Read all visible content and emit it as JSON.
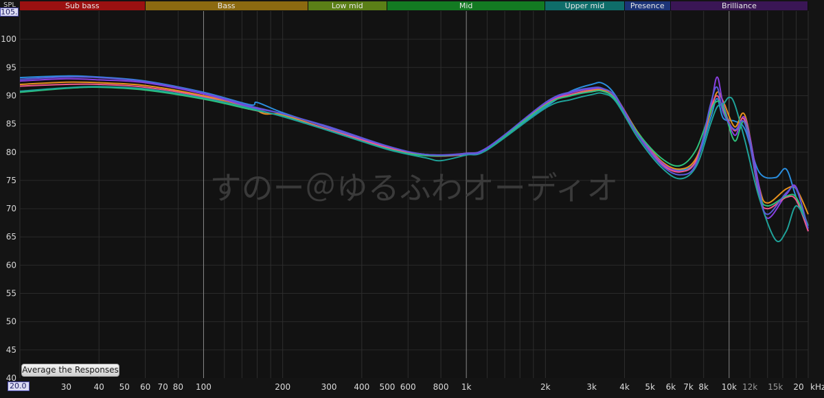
{
  "bands": [
    {
      "label": "Sub bass",
      "from": 20,
      "to": 60,
      "color": "#9b1111"
    },
    {
      "label": "Bass",
      "from": 60,
      "to": 250,
      "color": "#8c6a10"
    },
    {
      "label": "Low mid",
      "from": 250,
      "to": 500,
      "color": "#5b7f17"
    },
    {
      "label": "Mid",
      "from": 500,
      "to": 2000,
      "color": "#137a22"
    },
    {
      "label": "Upper mid",
      "from": 2000,
      "to": 4000,
      "color": "#0f6d6a"
    },
    {
      "label": "Presence",
      "from": 4000,
      "to": 6000,
      "color": "#1c3478"
    },
    {
      "label": "Brilliance",
      "from": 6000,
      "to": 20000,
      "color": "#3a1655"
    }
  ],
  "axis": {
    "y_unit": "SPL",
    "y_max_label": "105.0",
    "x_min_label": "20.0",
    "x_unit": "kHz"
  },
  "watermark": "すのー＠ゆるふわオーディオ",
  "button": {
    "label": "Average the Responses"
  },
  "chart_data": {
    "type": "line",
    "xscale": "log",
    "xlim": [
      20,
      20000
    ],
    "ylim": [
      40,
      105
    ],
    "grid": true,
    "y_ticks": [
      100,
      95,
      90,
      85,
      80,
      75,
      70,
      65,
      60,
      55,
      50,
      45,
      40
    ],
    "x_ticks": [
      {
        "value": 30,
        "label": "30"
      },
      {
        "value": 40,
        "label": "40"
      },
      {
        "value": 50,
        "label": "50"
      },
      {
        "value": 60,
        "label": "60"
      },
      {
        "value": 70,
        "label": "70"
      },
      {
        "value": 80,
        "label": "80"
      },
      {
        "value": 100,
        "label": "100"
      },
      {
        "value": 200,
        "label": "200"
      },
      {
        "value": 300,
        "label": "300"
      },
      {
        "value": 400,
        "label": "400"
      },
      {
        "value": 500,
        "label": "500"
      },
      {
        "value": 600,
        "label": "600"
      },
      {
        "value": 800,
        "label": "800"
      },
      {
        "value": 1000,
        "label": "1k"
      },
      {
        "value": 2000,
        "label": "2k"
      },
      {
        "value": 3000,
        "label": "3k"
      },
      {
        "value": 4000,
        "label": "4k"
      },
      {
        "value": 5000,
        "label": "5k"
      },
      {
        "value": 6000,
        "label": "6k"
      },
      {
        "value": 7000,
        "label": "7k"
      },
      {
        "value": 8000,
        "label": "8k"
      },
      {
        "value": 10000,
        "label": "10k"
      },
      {
        "value": 12000,
        "label": "12k",
        "minor": true
      },
      {
        "value": 15000,
        "label": "15k",
        "minor": true
      },
      {
        "value": 20000,
        "label": "20"
      }
    ],
    "series": [
      {
        "color": "#2a8fe0",
        "points": [
          [
            20,
            93.2
          ],
          [
            30,
            93.5
          ],
          [
            40,
            93.3
          ],
          [
            60,
            92.6
          ],
          [
            100,
            90.6
          ],
          [
            150,
            88.4
          ],
          [
            160,
            88.8
          ],
          [
            200,
            87.0
          ],
          [
            300,
            84.3
          ],
          [
            500,
            81.0
          ],
          [
            700,
            79.5
          ],
          [
            1000,
            79.8
          ],
          [
            1200,
            80.8
          ],
          [
            2000,
            88.0
          ],
          [
            2500,
            90.8
          ],
          [
            3000,
            92.0
          ],
          [
            3300,
            92.2
          ],
          [
            3700,
            90.0
          ],
          [
            4500,
            83.0
          ],
          [
            5500,
            78.0
          ],
          [
            6500,
            76.8
          ],
          [
            7500,
            78.5
          ],
          [
            8500,
            86.0
          ],
          [
            9000,
            89.5
          ],
          [
            9500,
            86.0
          ],
          [
            10500,
            85.5
          ],
          [
            11500,
            84.0
          ],
          [
            13000,
            76.5
          ],
          [
            15000,
            75.5
          ],
          [
            16500,
            77.0
          ],
          [
            18000,
            72.0
          ],
          [
            20000,
            67.0
          ]
        ]
      },
      {
        "color": "#e6921e",
        "points": [
          [
            20,
            92.0
          ],
          [
            30,
            92.4
          ],
          [
            40,
            92.3
          ],
          [
            60,
            91.8
          ],
          [
            100,
            90.0
          ],
          [
            150,
            87.9
          ],
          [
            170,
            86.8
          ],
          [
            200,
            86.6
          ],
          [
            300,
            84.0
          ],
          [
            500,
            80.8
          ],
          [
            700,
            79.6
          ],
          [
            1000,
            79.6
          ],
          [
            1200,
            80.6
          ],
          [
            2000,
            88.6
          ],
          [
            2500,
            90.2
          ],
          [
            3000,
            91.0
          ],
          [
            3300,
            91.0
          ],
          [
            3700,
            89.8
          ],
          [
            4500,
            83.5
          ],
          [
            5500,
            78.5
          ],
          [
            6500,
            77.0
          ],
          [
            7500,
            79.0
          ],
          [
            8500,
            87.0
          ],
          [
            9000,
            90.6
          ],
          [
            9500,
            89.0
          ],
          [
            10500,
            84.5
          ],
          [
            11500,
            86.5
          ],
          [
            13000,
            74.0
          ],
          [
            14000,
            71.0
          ],
          [
            16500,
            73.5
          ],
          [
            18000,
            73.5
          ],
          [
            20000,
            69.0
          ]
        ]
      },
      {
        "color": "#8a3fe0",
        "points": [
          [
            20,
            92.6
          ],
          [
            30,
            93.0
          ],
          [
            40,
            92.8
          ],
          [
            60,
            92.3
          ],
          [
            100,
            90.3
          ],
          [
            150,
            88.0
          ],
          [
            200,
            86.8
          ],
          [
            300,
            84.4
          ],
          [
            500,
            81.0
          ],
          [
            700,
            79.6
          ],
          [
            1000,
            79.8
          ],
          [
            1200,
            80.8
          ],
          [
            2000,
            88.6
          ],
          [
            2500,
            90.5
          ],
          [
            3000,
            91.2
          ],
          [
            3300,
            91.2
          ],
          [
            3700,
            89.8
          ],
          [
            4500,
            83.3
          ],
          [
            5500,
            78.3
          ],
          [
            6500,
            76.6
          ],
          [
            7500,
            78.5
          ],
          [
            8500,
            88.0
          ],
          [
            9000,
            93.3
          ],
          [
            9500,
            88.5
          ],
          [
            10500,
            83.0
          ],
          [
            11500,
            86.0
          ],
          [
            13000,
            74.0
          ],
          [
            14000,
            68.3
          ],
          [
            16500,
            72.5
          ],
          [
            18000,
            73.8
          ],
          [
            20000,
            66.0
          ]
        ]
      },
      {
        "color": "#ee5a8a",
        "points": [
          [
            20,
            91.7
          ],
          [
            30,
            92.0
          ],
          [
            40,
            92.0
          ],
          [
            60,
            91.5
          ],
          [
            100,
            89.8
          ],
          [
            150,
            87.6
          ],
          [
            200,
            86.4
          ],
          [
            300,
            84.0
          ],
          [
            500,
            80.8
          ],
          [
            700,
            79.4
          ],
          [
            1000,
            79.6
          ],
          [
            1200,
            80.6
          ],
          [
            2000,
            88.4
          ],
          [
            2500,
            90.2
          ],
          [
            3000,
            90.8
          ],
          [
            3300,
            90.8
          ],
          [
            3700,
            89.4
          ],
          [
            4500,
            83.0
          ],
          [
            5500,
            78.0
          ],
          [
            6500,
            76.5
          ],
          [
            7500,
            78.6
          ],
          [
            8500,
            87.5
          ],
          [
            9000,
            90.0
          ],
          [
            9500,
            87.5
          ],
          [
            10500,
            83.8
          ],
          [
            11500,
            85.5
          ],
          [
            13000,
            72.5
          ],
          [
            14000,
            70.0
          ],
          [
            16500,
            72.0
          ],
          [
            18000,
            71.5
          ],
          [
            20000,
            66.0
          ]
        ]
      },
      {
        "color": "#2ec27a",
        "points": [
          [
            20,
            90.6
          ],
          [
            30,
            91.3
          ],
          [
            40,
            91.5
          ],
          [
            60,
            91.0
          ],
          [
            100,
            89.4
          ],
          [
            150,
            87.6
          ],
          [
            200,
            86.4
          ],
          [
            300,
            83.8
          ],
          [
            500,
            80.6
          ],
          [
            700,
            79.4
          ],
          [
            1000,
            79.7
          ],
          [
            1200,
            80.6
          ],
          [
            2000,
            88.3
          ],
          [
            2500,
            90.0
          ],
          [
            3000,
            90.7
          ],
          [
            3300,
            90.8
          ],
          [
            3700,
            89.3
          ],
          [
            4500,
            83.4
          ],
          [
            5500,
            79.0
          ],
          [
            6500,
            77.6
          ],
          [
            7500,
            80.5
          ],
          [
            8500,
            87.3
          ],
          [
            9000,
            89.0
          ],
          [
            9500,
            88.0
          ],
          [
            10500,
            82.0
          ],
          [
            11500,
            85.2
          ],
          [
            13000,
            73.0
          ],
          [
            14000,
            70.5
          ],
          [
            16500,
            72.2
          ],
          [
            18000,
            72.0
          ],
          [
            20000,
            67.0
          ]
        ]
      },
      {
        "color": "#1fa39a",
        "points": [
          [
            20,
            90.8
          ],
          [
            30,
            91.4
          ],
          [
            40,
            91.6
          ],
          [
            60,
            91.2
          ],
          [
            100,
            89.6
          ],
          [
            150,
            87.8
          ],
          [
            200,
            86.3
          ],
          [
            300,
            83.8
          ],
          [
            500,
            80.5
          ],
          [
            700,
            79.0
          ],
          [
            800,
            78.5
          ],
          [
            1000,
            79.5
          ],
          [
            1200,
            80.4
          ],
          [
            2000,
            87.8
          ],
          [
            2500,
            89.3
          ],
          [
            3000,
            90.2
          ],
          [
            3300,
            90.4
          ],
          [
            3700,
            89.0
          ],
          [
            4500,
            82.5
          ],
          [
            5500,
            77.4
          ],
          [
            6500,
            75.3
          ],
          [
            7500,
            77.5
          ],
          [
            8500,
            85.0
          ],
          [
            9000,
            88.0
          ],
          [
            9500,
            88.5
          ],
          [
            10000,
            89.7
          ],
          [
            10500,
            88.5
          ],
          [
            11500,
            82.0
          ],
          [
            13000,
            72.0
          ],
          [
            15000,
            64.5
          ],
          [
            16500,
            66.0
          ],
          [
            18000,
            70.5
          ],
          [
            20000,
            67.0
          ]
        ]
      },
      {
        "color": "#5a5ad8",
        "points": [
          [
            20,
            92.9
          ],
          [
            30,
            93.3
          ],
          [
            40,
            93.2
          ],
          [
            60,
            92.5
          ],
          [
            100,
            90.5
          ],
          [
            150,
            88.2
          ],
          [
            200,
            86.8
          ],
          [
            300,
            84.5
          ],
          [
            500,
            81.1
          ],
          [
            700,
            79.6
          ],
          [
            1000,
            79.7
          ],
          [
            1200,
            80.7
          ],
          [
            2000,
            88.8
          ],
          [
            2500,
            90.7
          ],
          [
            3000,
            91.4
          ],
          [
            3300,
            91.3
          ],
          [
            3700,
            89.7
          ],
          [
            4500,
            83.0
          ],
          [
            5500,
            77.8
          ],
          [
            6500,
            76.0
          ],
          [
            7500,
            78.0
          ],
          [
            8500,
            88.5
          ],
          [
            9000,
            91.5
          ],
          [
            9500,
            87.0
          ],
          [
            10500,
            84.0
          ],
          [
            11500,
            85.0
          ],
          [
            13000,
            73.0
          ],
          [
            14000,
            69.0
          ],
          [
            16500,
            72.8
          ],
          [
            18000,
            73.5
          ],
          [
            20000,
            66.5
          ]
        ]
      }
    ]
  }
}
